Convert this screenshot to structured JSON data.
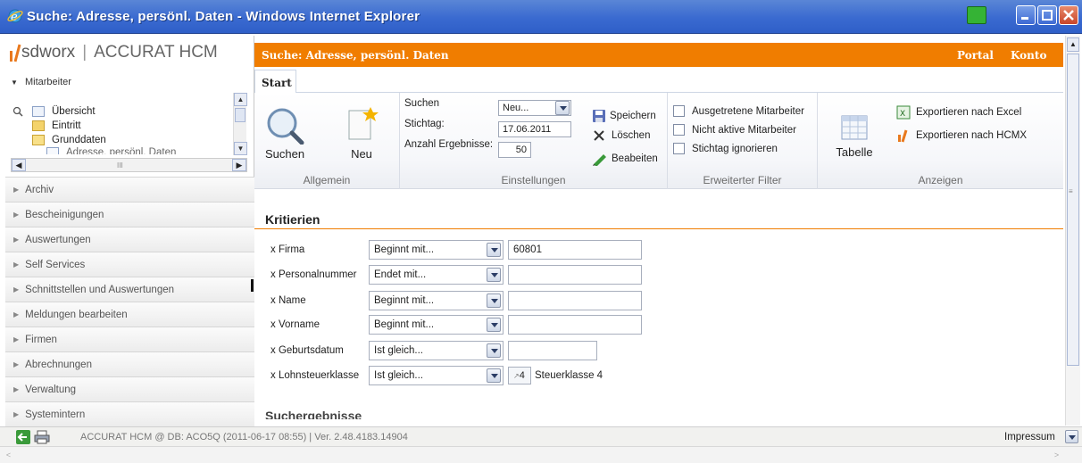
{
  "window": {
    "title": "Suche: Adresse, persönl. Daten - Windows Internet Explorer"
  },
  "brand": {
    "logo": "sdworx",
    "separator": "|",
    "product": "ACCURAT HCM"
  },
  "leftpanel": {
    "section_header": "Mitarbeiter",
    "tree": [
      {
        "label": "Übersicht",
        "icon": "overview-icon"
      },
      {
        "label": "Eintritt",
        "icon": "folder-icon"
      },
      {
        "label": "Grunddaten",
        "icon": "folder-open-icon"
      },
      {
        "label": "Adresse, persönl. Daten",
        "icon": "document-icon"
      }
    ],
    "nav": [
      "Archiv",
      "Bescheinigungen",
      "Auswertungen",
      "Self Services",
      "Schnittstellen und Auswertungen",
      "Meldungen bearbeiten",
      "Firmen",
      "Abrechnungen",
      "Verwaltung",
      "Systemintern"
    ]
  },
  "header": {
    "page_title": "Suche: Adresse, persönl. Daten",
    "links": [
      "Portal",
      "Konto"
    ]
  },
  "tabs": [
    {
      "label": "Start",
      "active": true
    }
  ],
  "ribbon": {
    "allgemein": {
      "group_label": "Allgemein",
      "suchen": "Suchen",
      "neu": "Neu"
    },
    "einstellungen": {
      "group_label": "Einstellungen",
      "suchen_label": "Suchen",
      "suchen_value": "Neu...",
      "stichtag_label": "Stichtag:",
      "stichtag_value": "17.06.2011",
      "anzahl_label": "Anzahl Ergebnisse:",
      "anzahl_value": "50",
      "speichern": "Speichern",
      "loeschen": "Löschen",
      "bearbeiten": "Beabeiten"
    },
    "filter": {
      "group_label": "Erweiterter Filter",
      "options": [
        {
          "label": "Ausgetretene Mitarbeiter",
          "checked": false
        },
        {
          "label": "Nicht aktive Mitarbeiter",
          "checked": false
        },
        {
          "label": "Stichtag ignorieren",
          "checked": false
        }
      ]
    },
    "anzeigen": {
      "group_label": "Anzeigen",
      "tabelle": "Tabelle",
      "excel": "Exportieren nach Excel",
      "hcmx": "Exportieren nach HCMX"
    }
  },
  "criteria": {
    "title": "Kritierien",
    "rows": [
      {
        "label": "x Firma",
        "operator": "Beginnt mit...",
        "value": "60801"
      },
      {
        "label": "x Personalnummer",
        "operator": "Endet mit...",
        "value": ""
      },
      {
        "label": "x Name",
        "operator": "Beginnt mit...",
        "value": ""
      },
      {
        "label": "x Vorname",
        "operator": "Beginnt mit...",
        "value": ""
      },
      {
        "label": "x Geburtsdatum",
        "operator": "Ist gleich...",
        "value": ""
      },
      {
        "label": "x Lohnsteuerklasse",
        "operator": "Ist gleich...",
        "value": "4",
        "value_desc": "Steuerklasse 4"
      }
    ],
    "next_section_partial": "Suchergebnisse"
  },
  "status": {
    "text": "ACCURAT HCM @ DB: ACO5Q (2011-06-17 08:55) | Ver. 2.48.4183.14904",
    "impressum": "Impressum"
  },
  "colors": {
    "accent_orange": "#f07d00",
    "titlebar_blue": "#3a6ad0"
  }
}
